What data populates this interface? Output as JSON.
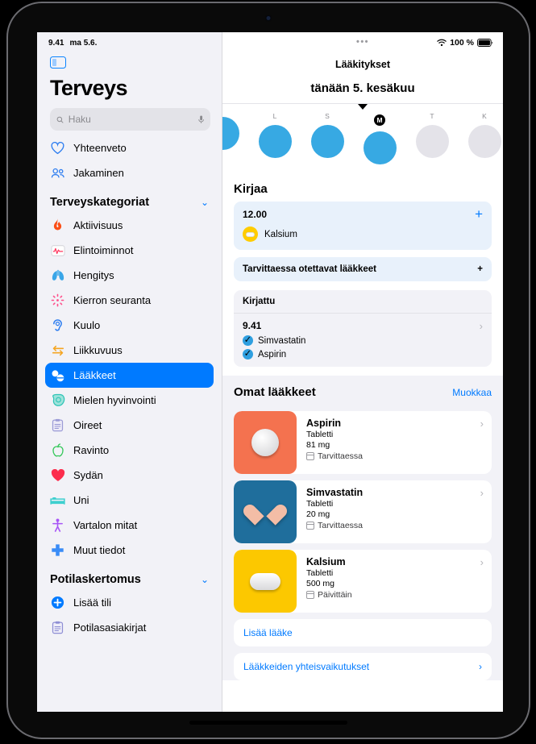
{
  "status": {
    "time": "9.41",
    "date": "ma 5.6.",
    "battery_pct": "100 %",
    "wifi_icon": "wifi-icon",
    "battery_icon": "battery-icon",
    "more_dots": "•••"
  },
  "sidebar": {
    "toggle_icon": "sidebar-toggle-icon",
    "title": "Terveys",
    "search": {
      "placeholder": "Haku",
      "value": "",
      "icon": "search-icon",
      "mic_icon": "microphone-icon"
    },
    "top_items": [
      {
        "label": "Yhteenveto",
        "icon": "heart-outline-icon",
        "color": "#2f7ef0"
      },
      {
        "label": "Jakaminen",
        "icon": "people-icon",
        "color": "#2f7ef0"
      }
    ],
    "categories_header": {
      "label": "Terveyskategoriat",
      "chevron": "⌄"
    },
    "categories": [
      {
        "label": "Aktiivisuus",
        "icon": "flame-icon",
        "color": "#fb4e16"
      },
      {
        "label": "Elintoiminnot",
        "icon": "vitals-icon",
        "color": "#ff375f"
      },
      {
        "label": "Hengitys",
        "icon": "lungs-icon",
        "color": "#3aa6e8"
      },
      {
        "label": "Kierron seuranta",
        "icon": "cycle-icon",
        "color": "#ff4f8b"
      },
      {
        "label": "Kuulo",
        "icon": "ear-icon",
        "color": "#2f7ef0"
      },
      {
        "label": "Liikkuvuus",
        "icon": "mobility-icon",
        "color": "#f5a623"
      },
      {
        "label": "Lääkkeet",
        "icon": "pills-icon",
        "color": "#ffffff",
        "selected": true
      },
      {
        "label": "Mielen hyvinvointi",
        "icon": "mind-icon",
        "color": "#2ec4b6"
      },
      {
        "label": "Oireet",
        "icon": "clipboard-icon",
        "color": "#9b9bd6"
      },
      {
        "label": "Ravinto",
        "icon": "apple-icon",
        "color": "#34c759"
      },
      {
        "label": "Sydän",
        "icon": "heart-filled-icon",
        "color": "#fc2d4d"
      },
      {
        "label": "Uni",
        "icon": "bed-icon",
        "color": "#3ecfcf"
      },
      {
        "label": "Vartalon mitat",
        "icon": "body-icon",
        "color": "#a855f7"
      },
      {
        "label": "Muut tiedot",
        "icon": "cross-icon",
        "color": "#3a8cf7"
      }
    ],
    "records_header": {
      "label": "Potilaskertomus",
      "chevron": "⌄"
    },
    "records": [
      {
        "label": "Lisää tili",
        "icon": "add-circle-icon",
        "color": "#007aff"
      },
      {
        "label": "Potilasasiakirjat",
        "icon": "records-icon",
        "color": "#8e8ed4"
      }
    ]
  },
  "main": {
    "nav_title": "Lääkitykset",
    "date_title": "tänään 5. kesäkuu",
    "caret_icon": "caret-down-icon",
    "days": [
      {
        "letter": "",
        "filled": true,
        "today": false,
        "partial": true
      },
      {
        "letter": "L",
        "filled": true,
        "today": false
      },
      {
        "letter": "S",
        "filled": true,
        "today": false
      },
      {
        "letter": "M",
        "filled": true,
        "today": true
      },
      {
        "letter": "T",
        "filled": false,
        "today": false
      },
      {
        "letter": "K",
        "filled": false,
        "today": false
      }
    ],
    "log_section": {
      "heading": "Kirjaa",
      "entry": {
        "time": "12.00",
        "med_name": "Kalsium",
        "pill_icon": "capsule-pill-icon",
        "add_icon": "plus-icon"
      },
      "as_needed": {
        "label": "Tarvittaessa otettavat lääkkeet",
        "add_icon": "plus-icon"
      }
    },
    "logged_section": {
      "heading": "Kirjattu",
      "time": "9.41",
      "chevron_icon": "chevron-right-icon",
      "items": [
        {
          "label": "Simvastatin",
          "check_icon": "check-circle-icon"
        },
        {
          "label": "Aspirin",
          "check_icon": "check-circle-icon"
        }
      ]
    },
    "my_meds": {
      "heading": "Omat lääkkeet",
      "edit_label": "Muokkaa",
      "items": [
        {
          "name": "Aspirin",
          "form": "Tabletti",
          "dose": "81 mg",
          "frequency": "Tarvittaessa",
          "tile_color": "#f4724f",
          "pill_shape": "round",
          "calendar_icon": "calendar-icon",
          "chevron_icon": "chevron-right-icon"
        },
        {
          "name": "Simvastatin",
          "form": "Tabletti",
          "dose": "20 mg",
          "frequency": "Tarvittaessa",
          "tile_color": "#1f6e9c",
          "pill_shape": "heart",
          "calendar_icon": "calendar-icon",
          "chevron_icon": "chevron-right-icon"
        },
        {
          "name": "Kalsium",
          "form": "Tabletti",
          "dose": "500 mg",
          "frequency": "Päivittäin",
          "tile_color": "#fcc800",
          "pill_shape": "capsule",
          "calendar_icon": "calendar-icon",
          "chevron_icon": "chevron-right-icon"
        }
      ],
      "add_label": "Lisää lääke",
      "interactions_label": "Lääkkeiden yhteisvaikutukset"
    }
  }
}
